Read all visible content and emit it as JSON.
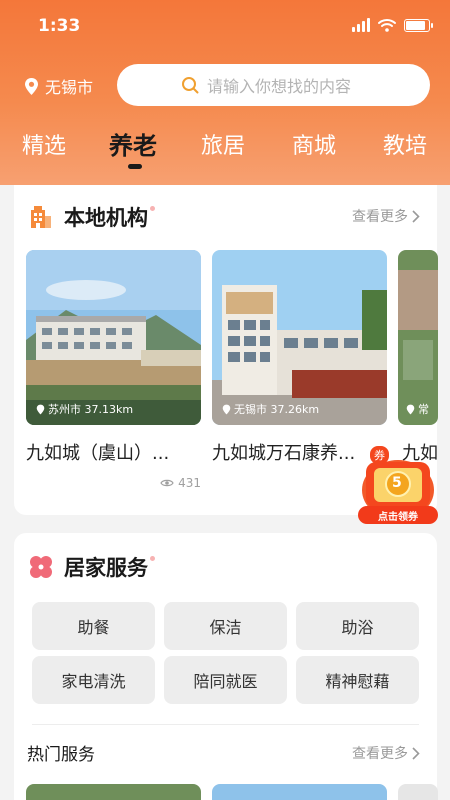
{
  "status": {
    "time": "1:33"
  },
  "header": {
    "location": "无锡市",
    "search_placeholder": "请输入你想找的内容",
    "tabs": [
      "精选",
      "养老",
      "旅居",
      "商城",
      "教培"
    ],
    "active_tab": "养老"
  },
  "local_section": {
    "title": "本地机构",
    "more": "查看更多",
    "items": [
      {
        "distance": "苏州市 37.13km",
        "name": "九如城（虞山）...",
        "views": "431"
      },
      {
        "distance": "无锡市 37.26km",
        "name": "九如城万石康养...",
        "views": ""
      },
      {
        "distance": "常",
        "name": "九如",
        "views": ""
      }
    ]
  },
  "coupon": {
    "top_label": "券",
    "value": "5",
    "action": "点击领券"
  },
  "home_service": {
    "title": "居家服务",
    "chips": [
      "助餐",
      "保洁",
      "助浴",
      "家电清洗",
      "陪同就医",
      "精神慰藉"
    ]
  },
  "hot_services": {
    "title": "热门服务",
    "more": "查看更多"
  },
  "colors": {
    "accent": "#f4773a",
    "text": "#1a1a1a",
    "muted": "#9a9a9a",
    "chip_bg": "#ededed"
  }
}
